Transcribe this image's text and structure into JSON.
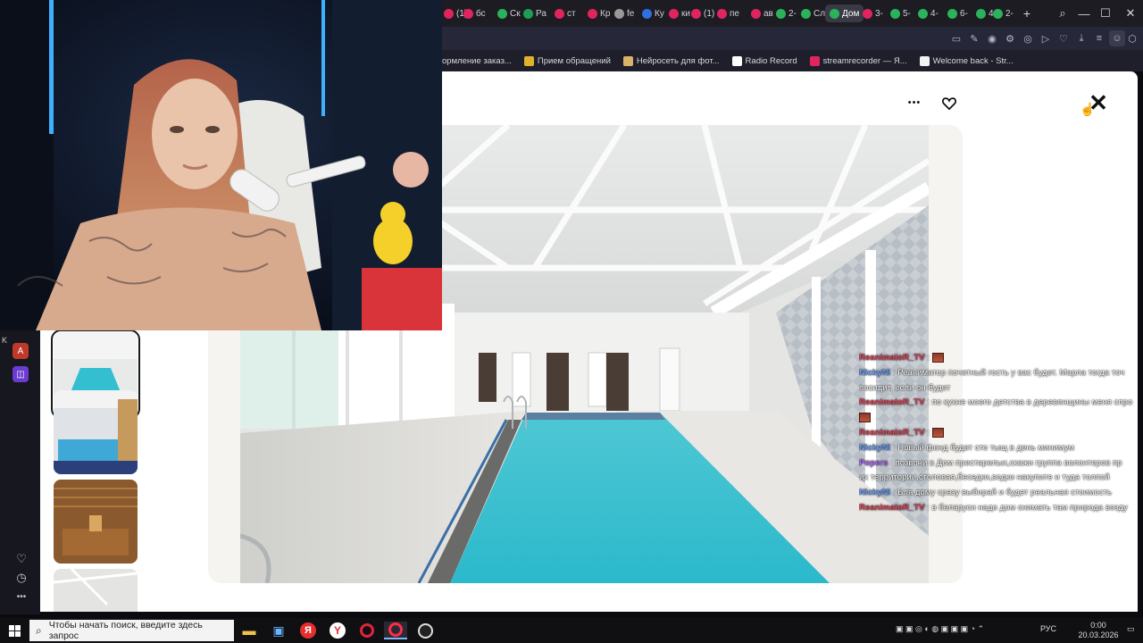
{
  "browser": {
    "tabs": [
      {
        "label": "(1)",
        "color": "#e0245e"
      },
      {
        "label": "бс",
        "color": "#e0245e"
      },
      {
        "label": "Ск",
        "color": "#29b35a"
      },
      {
        "label": "Ра",
        "color": "#1f9d55"
      },
      {
        "label": "ст",
        "color": "#e0245e"
      },
      {
        "label": "Кр",
        "color": "#e0245e"
      },
      {
        "label": "fe",
        "color": "#999999"
      },
      {
        "label": "Ку",
        "color": "#2f6fe0"
      },
      {
        "label": "ки",
        "color": "#e0245e"
      },
      {
        "label": "(1)",
        "color": "#e0245e"
      },
      {
        "label": "пе",
        "color": "#e0245e"
      },
      {
        "label": "ав",
        "color": "#e0245e"
      },
      {
        "label": "2-",
        "color": "#29b35a"
      },
      {
        "label": "Сл",
        "color": "#29b35a"
      },
      {
        "label": "Дом",
        "color": "#29b35a"
      },
      {
        "label": "3-",
        "color": "#e0245e"
      },
      {
        "label": "5-",
        "color": "#29b35a"
      },
      {
        "label": "4-",
        "color": "#29b35a"
      },
      {
        "label": "6-",
        "color": "#29b35a"
      },
      {
        "label": "4-",
        "color": "#29b35a"
      },
      {
        "label": "2-",
        "color": "#29b35a"
      }
    ],
    "active_tab_index": 14,
    "new_tab_label": "+",
    "window_controls": {
      "search": "⌕",
      "minimize": "—",
      "maximize": "☐",
      "close": "✕"
    },
    "bookmarks": [
      {
        "label": "ормление заказ...",
        "color": "#3a3a48"
      },
      {
        "label": "Прием обращений",
        "color": "#e1b12c"
      },
      {
        "label": "Нейросеть для фот...",
        "color": "#d9b36a"
      },
      {
        "label": "Radio Record",
        "color": "#ffffff"
      },
      {
        "label": "streamrecorder — Я...",
        "color": "#e0245e"
      },
      {
        "label": "Welcome back - Str...",
        "color": "#f2f2f2"
      }
    ]
  },
  "viewer": {
    "more_label": "•••",
    "favorite_icon": "heart-icon",
    "close_label": "✕",
    "thumbnails": [
      {
        "name": "thumb-pool",
        "selected": true
      },
      {
        "name": "thumb-pool-sauna-room",
        "selected": false
      },
      {
        "name": "thumb-sauna",
        "selected": false
      },
      {
        "name": "thumb-ceiling",
        "selected": false
      }
    ]
  },
  "left_rail": {
    "icons": [
      "app-red-icon",
      "app-purple-icon",
      "heart-icon",
      "history-icon",
      "more-icon"
    ],
    "more_label": "•••"
  },
  "chat": [
    {
      "user": "ReanimatoR_TV",
      "user_color": "#e0455a",
      "text": ":",
      "emote": true
    },
    {
      "user": "NickyNi",
      "user_color": "#6aa0ff",
      "text": ": Реаниматор почетный гость у вас будет. Марла тогда точ"
    },
    {
      "user": "",
      "user_color": "#ffffff",
      "text": "посидит, если он будет"
    },
    {
      "user": "ReanimatoR_TV",
      "user_color": "#e0455a",
      "text": ": по кухне моего детства в деревянщины меня спро"
    },
    {
      "user": "",
      "user_color": "#ffffff",
      "text": "",
      "emote": true
    },
    {
      "user": "ReanimatoR_TV",
      "user_color": "#e0455a",
      "text": ":",
      "emote": true
    },
    {
      "user": "NickyNi",
      "user_color": "#6aa0ff",
      "text": ": Новый фонд будет сто тыщ в день минимум"
    },
    {
      "user": "Popers",
      "user_color": "#b06cff",
      "text": ": позвони в Дом престарелых,скажи группа волонтеров пр"
    },
    {
      "user": "",
      "user_color": "#ffffff",
      "text": "их территории,столовая,беседки,водки накупите и туда толпой"
    },
    {
      "user": "NickyNi",
      "user_color": "#6aa0ff",
      "text": ": Бля дому сразу выбирай и будет реальная стоимость"
    },
    {
      "user": "ReanimatoR_TV",
      "user_color": "#e0455a",
      "text": ": в беларуси надо дом снимать там природа возду"
    }
  ],
  "taskbar": {
    "start_icon": "windows-start-icon",
    "search_placeholder": "Чтобы начать поиск, введите здесь запрос",
    "apps": [
      "file-explorer-icon",
      "store-icon",
      "yandex-icon",
      "yandex-browser-icon",
      "opera-icon",
      "opera-gx-icon",
      "obs-icon"
    ],
    "language": "РУС",
    "time": "0:00",
    "date": "20.03.2026"
  }
}
